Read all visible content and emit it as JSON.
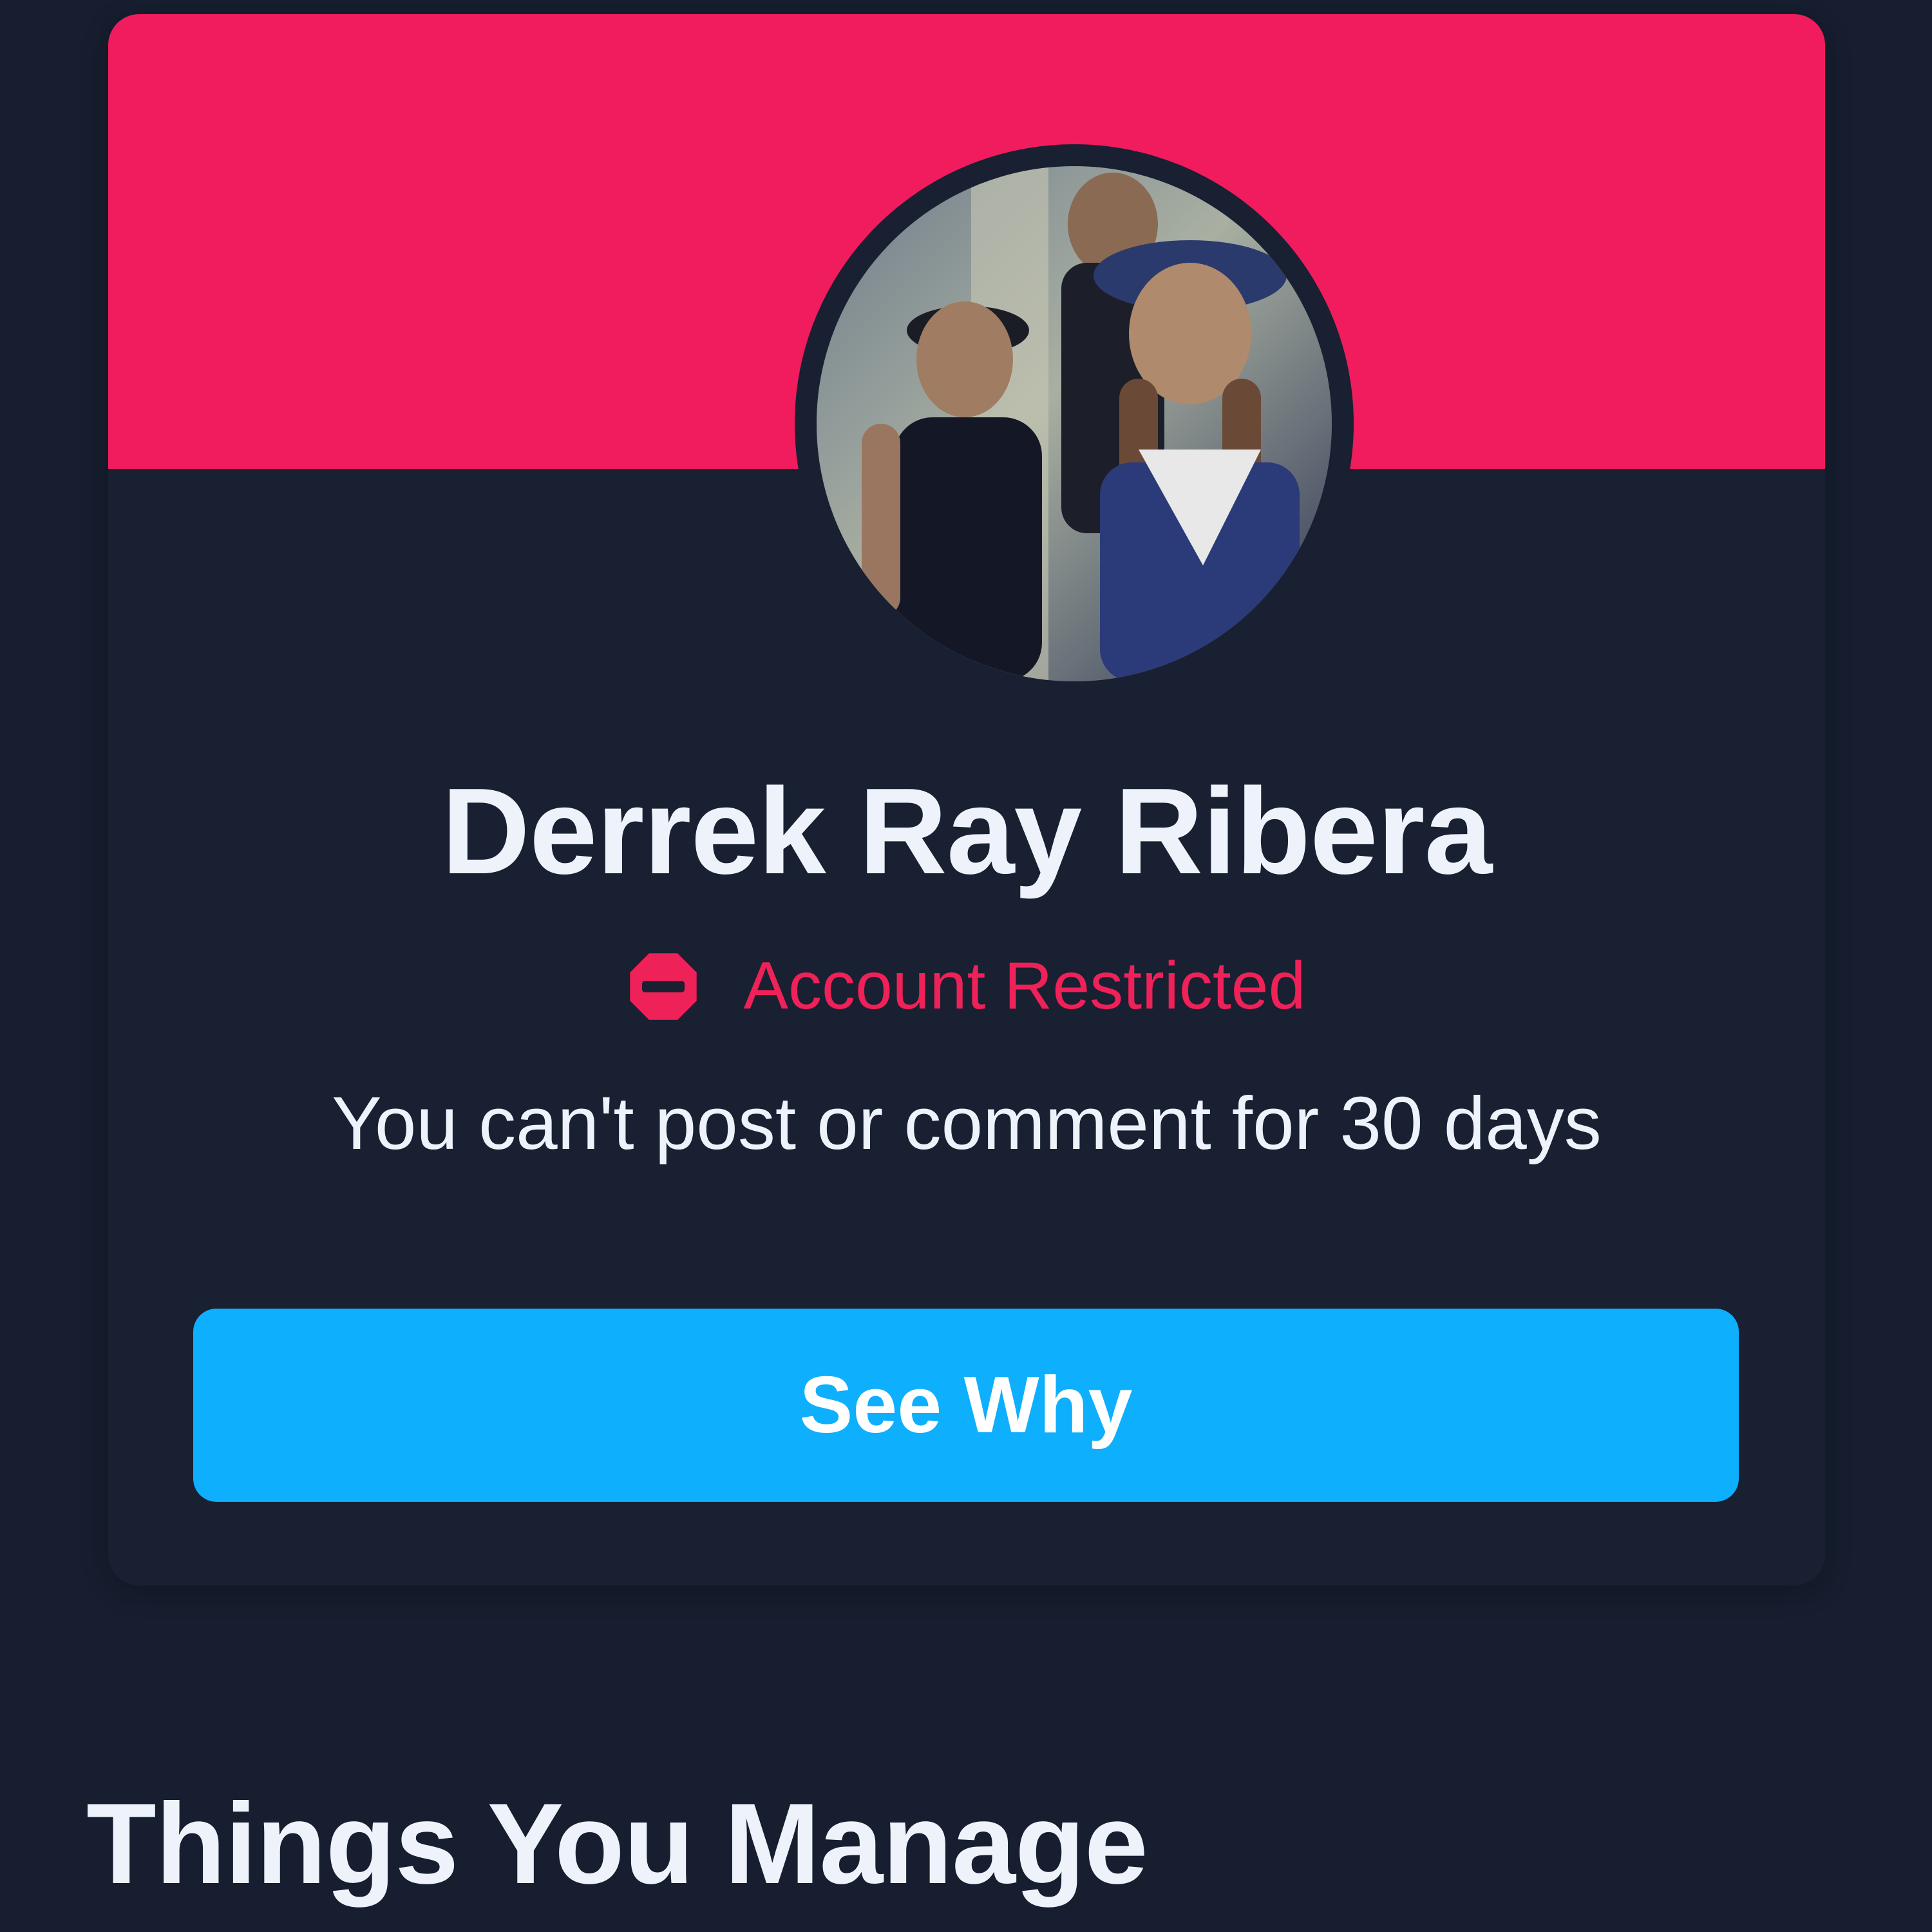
{
  "profile": {
    "name": "Derrek Ray Ribera",
    "avatar_alt": "profile-photo"
  },
  "status": {
    "icon": "stop-icon",
    "label": "Account Restricted",
    "color": "#ef2159"
  },
  "restriction": {
    "message": "You can't post or comment for 30 days"
  },
  "actions": {
    "see_why_label": "See Why"
  },
  "sections": {
    "things_you_manage_title": "Things You Manage"
  },
  "colors": {
    "background": "#161e2f",
    "banner": "#f01c5e",
    "button": "#0eaffc",
    "text": "#eef3fb"
  }
}
